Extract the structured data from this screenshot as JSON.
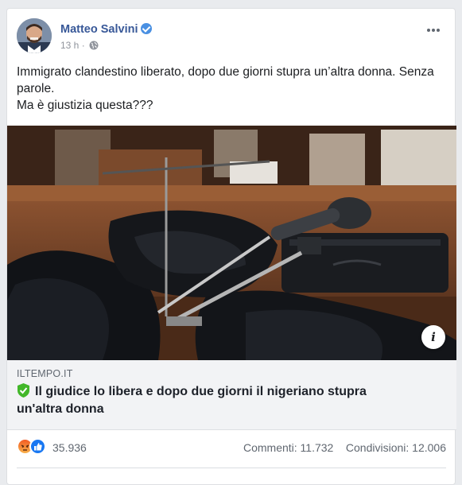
{
  "post": {
    "author": "Matteo Salvini",
    "time": "13 h",
    "text_lines": [
      "Immigrato clandestino liberato, dopo due giorni stupra un’altra donna. Senza",
      "parole.",
      "Ma è giustizia questa???"
    ]
  },
  "link": {
    "domain": "ILTEMPO.IT",
    "title_line1": "Il giudice lo libera e dopo due giorni il nigeriano stupra",
    "title_line2": "un'altra donna"
  },
  "stats": {
    "reactions_count": "35.936",
    "comments": "Commenti: 11.732",
    "shares": "Condivisioni: 12.006"
  },
  "icons": {
    "verified": "verified-badge-icon",
    "privacy": "globe-icon",
    "more": "more-options-icon",
    "info": "info-icon",
    "shield": "shield-check-icon",
    "reactions": [
      "angry-reaction-icon",
      "like-reaction-icon"
    ]
  },
  "colors": {
    "author_link": "#385898",
    "verified": "#4a90e2",
    "shield": "#42b72a",
    "like": "#1877f2",
    "angry": "#f35b24"
  }
}
